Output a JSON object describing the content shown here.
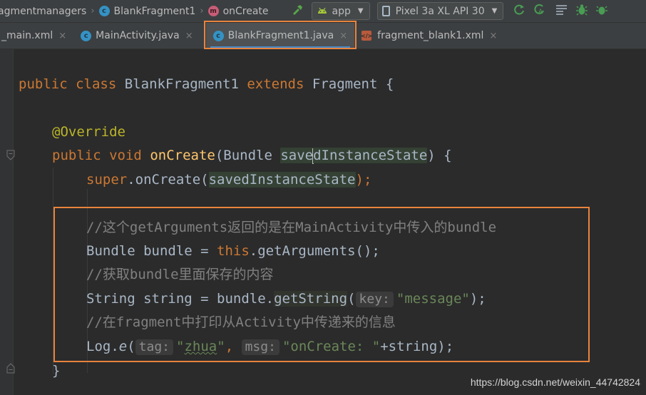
{
  "breadcrumb": {
    "items": [
      {
        "label": "agmentmanagers",
        "icon": ""
      },
      {
        "label": "BlankFragment1",
        "icon": "class-icon"
      },
      {
        "label": "onCreate",
        "icon": "method-icon"
      }
    ]
  },
  "toolbar": {
    "run_config": "app",
    "device": "Pixel 3a XL API 30"
  },
  "tabs": [
    {
      "label": "_main.xml",
      "icon": ""
    },
    {
      "label": "MainActivity.java",
      "icon": "class-icon"
    },
    {
      "label": "BlankFragment1.java",
      "icon": "class-icon",
      "active": true
    },
    {
      "label": "fragment_blank1.xml",
      "icon": "xml-icon"
    }
  ],
  "icons": {
    "class_glyph": "c",
    "method_glyph": "m",
    "close_glyph": "×",
    "xml_glyph": "</>"
  },
  "code": {
    "l1_public": "public",
    "l1_class": "class",
    "l1_name": "BlankFragment1",
    "l1_extends": "extends",
    "l1_parent": "Fragment {",
    "l2_override": "@Override",
    "l3_public": "public",
    "l3_void": "void",
    "l3_method": "onCreate",
    "l3_open": "(Bundle ",
    "l3_param_a": "save",
    "l3_param_b": "dInstanceState",
    "l3_close": ") {",
    "l4_super": "super",
    "l4_call": ".onCreate(",
    "l4_arg": "savedInstanceState",
    "l4_end": ");",
    "l5_comment": "//这个getArguments返回的是在MainActivity中传入的bundle",
    "l6_type": "Bundle bundle = ",
    "l6_this": "this",
    "l6_rest": ".getArguments();",
    "l7_comment": "//获取bundle里面保存的内容",
    "l8_type": "String string = bundle.",
    "l8_method": "getString",
    "l8_paren": "(",
    "l8_hint": "key:",
    "l8_str": "\"message\"",
    "l8_end": ");",
    "l9_comment": "//在fragment中打印从Activity中传递来的信息",
    "l10_log": "Log.",
    "l10_e": "e",
    "l10_paren": "(",
    "l10_hint_tag": "tag:",
    "l10_q1": "\"",
    "l10_zhua": "zhua",
    "l10_q2": "\"",
    "l10_comma": ", ",
    "l10_hint_msg": "msg:",
    "l10_str": "\"onCreate: \"",
    "l10_end": "+string);",
    "l11_brace": "}"
  },
  "watermark": "https://blog.csdn.net/weixin_44742824"
}
